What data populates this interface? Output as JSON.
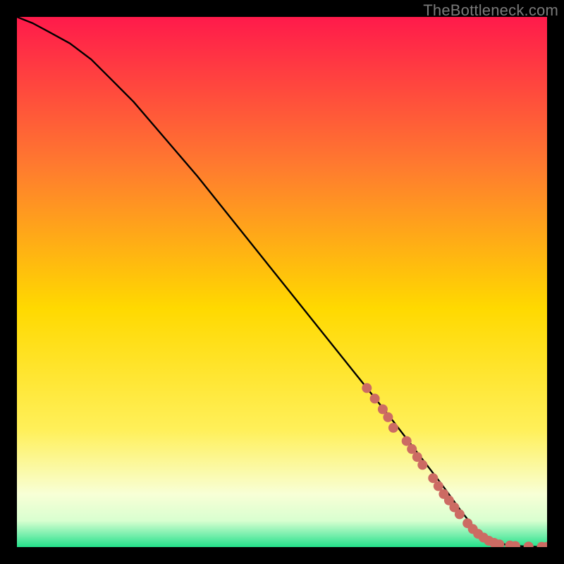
{
  "watermark": "TheBottleneck.com",
  "colors": {
    "bg": "#000000",
    "gradient_top": "#ff1a4b",
    "gradient_mid_upper": "#ff8a2a",
    "gradient_mid": "#ffd900",
    "gradient_lower": "#fff66e",
    "gradient_pale": "#f8ffd6",
    "gradient_green": "#23e08a",
    "curve": "#000000",
    "marker": "#cc6b63"
  },
  "chart_data": {
    "type": "line",
    "title": "",
    "xlabel": "",
    "ylabel": "",
    "xlim": [
      0,
      100
    ],
    "ylim": [
      0,
      100
    ],
    "series": [
      {
        "name": "curve",
        "x": [
          0,
          3,
          6,
          10,
          14,
          18,
          22,
          28,
          34,
          40,
          46,
          52,
          58,
          64,
          70,
          75,
          80,
          84,
          86,
          88,
          90,
          92,
          94,
          96,
          98,
          100
        ],
        "y": [
          100,
          98.8,
          97.2,
          95,
          92,
          88,
          84,
          77,
          70,
          62.5,
          55,
          47.5,
          40,
          32.5,
          25,
          18.5,
          12,
          6.5,
          4,
          2.2,
          1.1,
          0.5,
          0.25,
          0.1,
          0.05,
          0
        ]
      }
    ],
    "markers": [
      {
        "x": 66,
        "y": 30
      },
      {
        "x": 67.5,
        "y": 28
      },
      {
        "x": 69,
        "y": 26
      },
      {
        "x": 70,
        "y": 24.5
      },
      {
        "x": 71,
        "y": 22.5
      },
      {
        "x": 73.5,
        "y": 20
      },
      {
        "x": 74.5,
        "y": 18.5
      },
      {
        "x": 75.5,
        "y": 17
      },
      {
        "x": 76.5,
        "y": 15.5
      },
      {
        "x": 78.5,
        "y": 13
      },
      {
        "x": 79.5,
        "y": 11.5
      },
      {
        "x": 80.5,
        "y": 10
      },
      {
        "x": 81.5,
        "y": 8.8
      },
      {
        "x": 82.5,
        "y": 7.5
      },
      {
        "x": 83.5,
        "y": 6.2
      },
      {
        "x": 85,
        "y": 4.5
      },
      {
        "x": 86,
        "y": 3.4
      },
      {
        "x": 87,
        "y": 2.5
      },
      {
        "x": 88,
        "y": 1.8
      },
      {
        "x": 89,
        "y": 1.2
      },
      {
        "x": 90,
        "y": 0.8
      },
      {
        "x": 91,
        "y": 0.5
      },
      {
        "x": 93,
        "y": 0.3
      },
      {
        "x": 94,
        "y": 0.2
      },
      {
        "x": 96.5,
        "y": 0.1
      },
      {
        "x": 99,
        "y": 0.05
      },
      {
        "x": 100,
        "y": 0.05
      }
    ]
  }
}
